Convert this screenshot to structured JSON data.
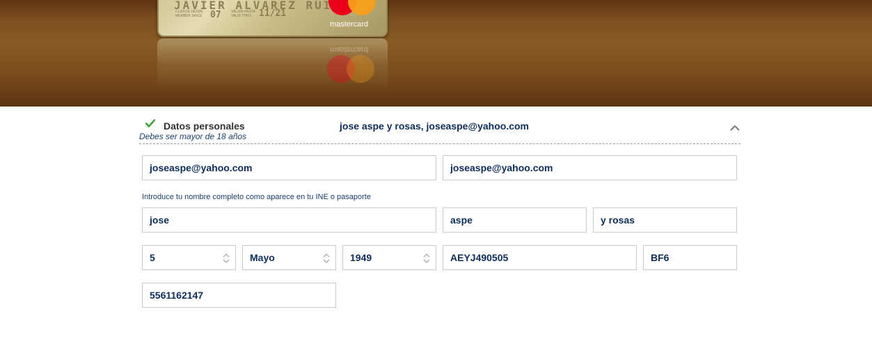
{
  "hero": {
    "card": {
      "holder_name": "JAVIER ALVAREZ RUIZ",
      "member_since_label": "CLIENTE DESDE",
      "member_since_label_en": "MEMBER SINCE",
      "member_since_value": "07",
      "valid_thru_label": "VALIDA HASTA",
      "valid_thru_label_en": "VALID THRU",
      "valid_thru_value": "11/21",
      "brand": "mastercard"
    },
    "colors": {
      "bg_dark": "#5e3512",
      "bg_mid": "#8a5a25"
    }
  },
  "section": {
    "title": "Datos personales",
    "subtitle": "Debes ser mayor de 18 años",
    "summary": "jose aspe y rosas, joseaspe@yahoo.com",
    "status_icon": "check-icon",
    "toggle_icon": "chevron-up-icon",
    "check_color": "#2ca02c"
  },
  "form": {
    "email": "joseaspe@yahoo.com",
    "email_confirm": "joseaspe@yahoo.com",
    "name_helper": "Introduce tu nombre completo como aparece en tu INE o pasaporte",
    "first_name": "jose",
    "last_name_1": "aspe",
    "last_name_2": "y rosas",
    "birth_day": "5",
    "birth_month": "Mayo",
    "birth_year": "1949",
    "rfc": "AEYJ490505",
    "homoclave": "BF6",
    "phone": "5561162147"
  }
}
